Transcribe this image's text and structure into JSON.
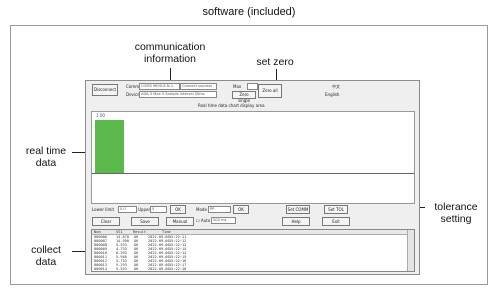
{
  "header": {
    "title": "software (included)"
  },
  "callouts": {
    "communication": "communication\ninformation",
    "set_zero": "set zero",
    "real_time": "real time\ndata",
    "tolerance": "tolerance\nsetting",
    "collect": "collect\ndata"
  },
  "app": {
    "disconnect_label": "Disconnect",
    "comm_label": "Comm",
    "comm_value": "COM3 9600-8-N-1",
    "status_value": "Connect success",
    "device_label": "Device",
    "device_value": "ADA-5  Max 5 Sample interval 50ms",
    "max_label": "Max",
    "zero_all_label": "Zero all",
    "zero_single_label": "Zero single",
    "lang_cn": "中文",
    "lang_en": "English",
    "chart_title": "Real time data chart display area",
    "chart_legend": "1.00",
    "chart_value": 0.88,
    "lower_limit_label": "Lower limit",
    "lower_limit_value": "0.0",
    "upper_label": "Upper",
    "upper_value": "5",
    "ok_label": "OK",
    "mode_label": "Mode",
    "mode_value": "PP",
    "ok2_label": "OK",
    "set_com_label": "Set COMM",
    "set_tol_label": "Set TOL",
    "clear_label": "Clear",
    "save_label": "Save",
    "manual_label": "Manual",
    "auto_label": "Auto",
    "auto_ms": "500 ms",
    "help_label": "Help",
    "exit_label": "Exit",
    "columns": [
      "Num",
      "SS1",
      "Result",
      "Time"
    ],
    "rows": [
      [
        "000006",
        "14.870",
        "OK",
        "2022-09-06",
        "15:22:11"
      ],
      [
        "000007",
        "14.990",
        "OK",
        "2022-09-06",
        "15:22:12"
      ],
      [
        "000008",
        "5.533",
        "OK",
        "2022-09-06",
        "15:22:13"
      ],
      [
        "000009",
        "4.733",
        "OK",
        "2022-09-06",
        "15:22:14"
      ],
      [
        "000010",
        "6.293",
        "OK",
        "2022-09-06",
        "15:22:14"
      ],
      [
        "000011",
        "5.940",
        "OK",
        "2022-09-06",
        "15:22:15"
      ],
      [
        "000012",
        "5.733",
        "OK",
        "2022-09-06",
        "15:22:16"
      ],
      [
        "000013",
        "5.293",
        "OK",
        "2022-09-06",
        "15:22:17"
      ],
      [
        "000014",
        "5.533",
        "OK",
        "2022-09-06",
        "15:22:18"
      ]
    ]
  }
}
